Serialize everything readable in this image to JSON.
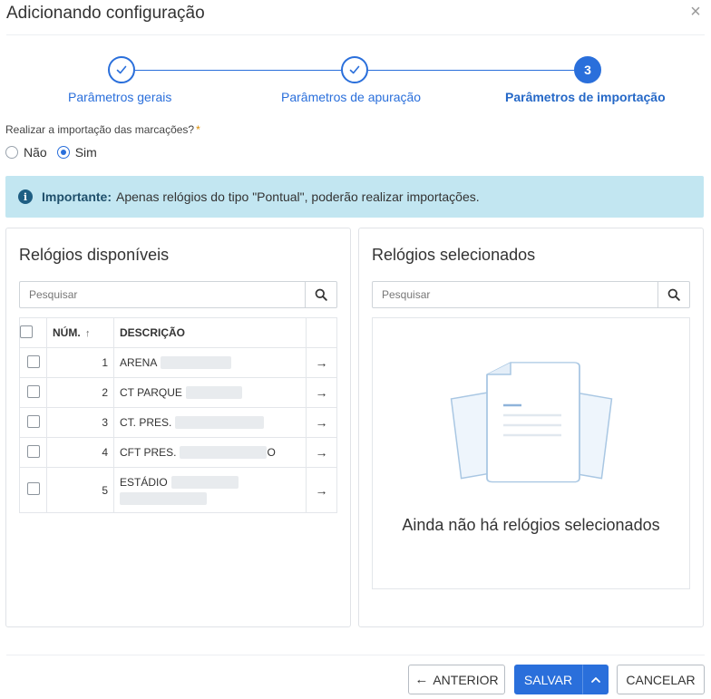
{
  "dialog": {
    "title": "Adicionando configuração",
    "close_icon": "close-icon"
  },
  "stepper": {
    "steps": [
      {
        "label": "Parâmetros gerais",
        "state": "done"
      },
      {
        "label": "Parâmetros de apuração",
        "state": "done"
      },
      {
        "label": "Parâmetros de importação",
        "state": "active",
        "number": "3"
      }
    ],
    "accent": "#2a6fdb"
  },
  "import_question": {
    "label": "Realizar a importação das marcações?",
    "required_mark": "*",
    "options": [
      {
        "label": "Não",
        "checked": false
      },
      {
        "label": "Sim",
        "checked": true
      }
    ]
  },
  "alert": {
    "strong": "Importante:",
    "text": "Apenas relógios do tipo \"Pontual\", poderão realizar importações.",
    "background": "#c2e6f1"
  },
  "available": {
    "title": "Relógios disponíveis",
    "search_placeholder": "Pesquisar",
    "columns": {
      "num": "NÚM.",
      "desc": "DESCRIÇÃO"
    },
    "rows": [
      {
        "num": "1",
        "desc": "ARENA"
      },
      {
        "num": "2",
        "desc": "CT PARQUE"
      },
      {
        "num": "3",
        "desc": "CT. PRES."
      },
      {
        "num": "4",
        "desc": "CFT PRES.",
        "suffix": "O"
      },
      {
        "num": "5",
        "desc": "ESTÁDIO"
      }
    ]
  },
  "selected": {
    "title": "Relógios selecionados",
    "search_placeholder": "Pesquisar",
    "empty_text": "Ainda não há relógios selecionados"
  },
  "footer": {
    "previous": "ANTERIOR",
    "save": "SALVAR",
    "cancel": "CANCELAR"
  }
}
